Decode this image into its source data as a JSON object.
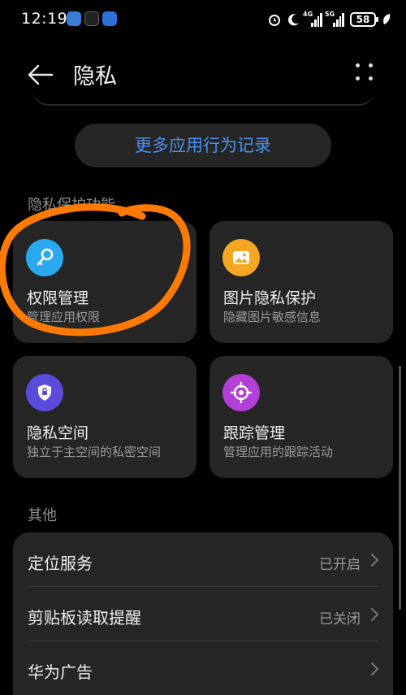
{
  "status_bar": {
    "time": "12:19",
    "battery": "58",
    "signal_1_tag": "4G",
    "signal_2_tag": "5G"
  },
  "header": {
    "title": "隐私",
    "back_icon": "arrow-left-icon",
    "more_icon": "more-dots-icon"
  },
  "more_records_button": "更多应用行为记录",
  "privacy_section": {
    "label": "隐私保护功能",
    "cards": [
      {
        "title": "权限管理",
        "subtitle": "管理应用权限",
        "icon": "key-icon",
        "color": "#2aa8f0"
      },
      {
        "title": "图片隐私保护",
        "subtitle": "隐藏图片敏感信息",
        "icon": "image-icon",
        "color": "#f5a623"
      },
      {
        "title": "隐私空间",
        "subtitle": "独立于主空间的私密空间",
        "icon": "shield-icon",
        "color": "#5b4bdb"
      },
      {
        "title": "跟踪管理",
        "subtitle": "管理应用的跟踪活动",
        "icon": "target-icon",
        "color": "#b23fd6"
      }
    ]
  },
  "other_section": {
    "label": "其他",
    "rows": [
      {
        "label": "定位服务",
        "value": "已开启"
      },
      {
        "label": "剪贴板读取提醒",
        "value": "已关闭"
      },
      {
        "label": "华为广告",
        "value": ""
      }
    ]
  },
  "colors": {
    "accent_blue": "#4a90f0",
    "annotation_orange": "#ff7a00"
  }
}
